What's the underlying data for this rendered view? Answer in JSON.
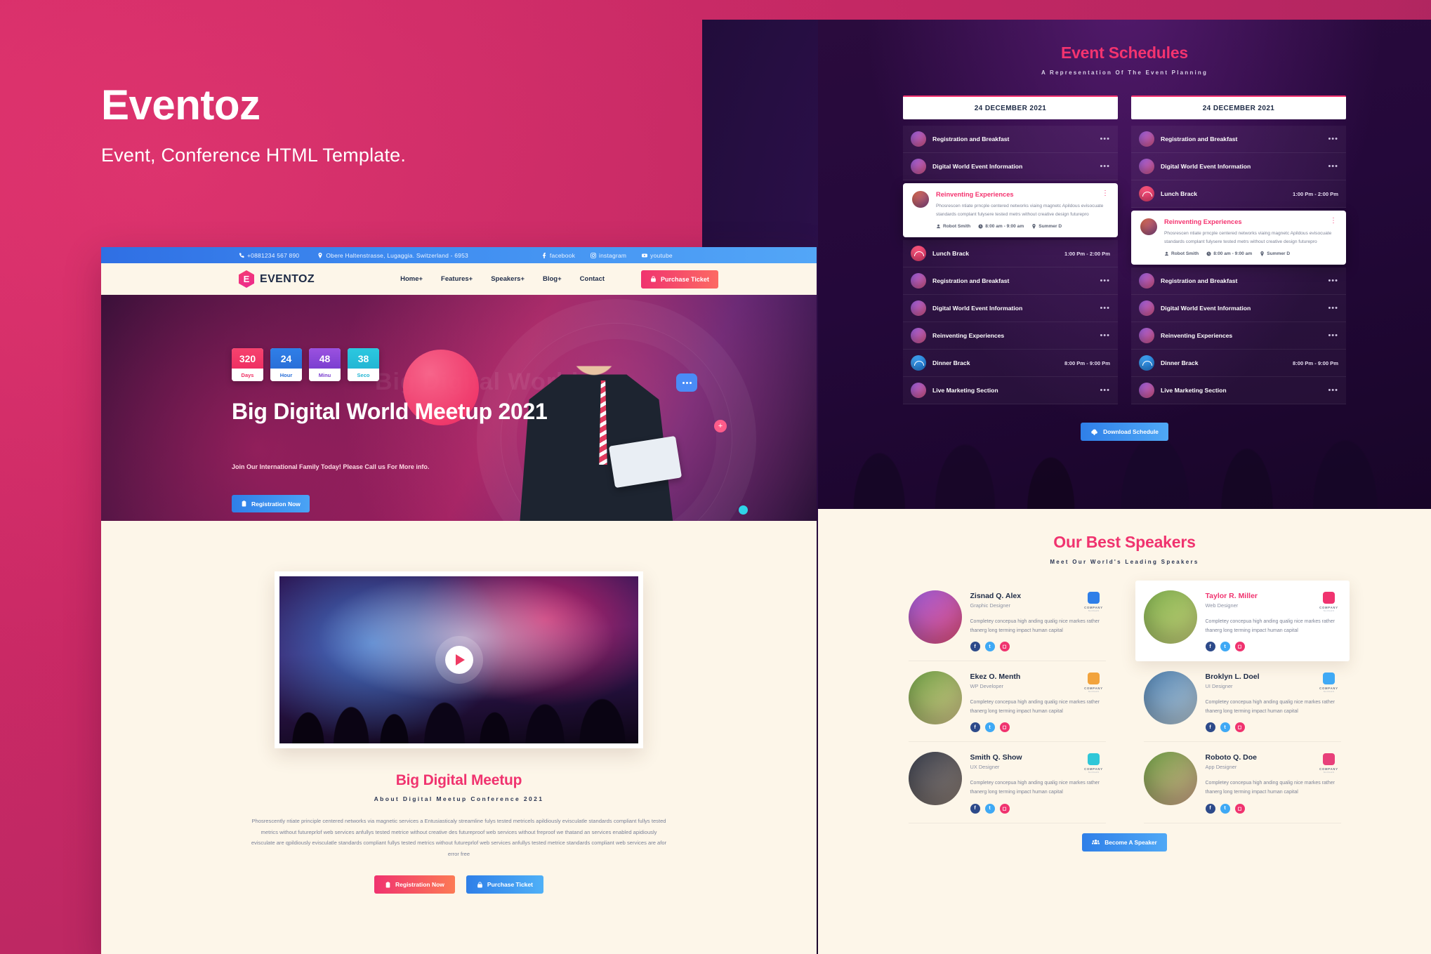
{
  "promo": {
    "title": "Eventoz",
    "subtitle": "Event, Conference HTML Template."
  },
  "colors": {
    "pink": "#f0336f",
    "blue": "#2f7fe8",
    "dark_navy": "#1d2a45",
    "cream": "#fdf6e9"
  },
  "site": {
    "topbar": {
      "phone": "+0881234 567 890",
      "address": "Obere Haltenstrasse, Lugaggia. Switzerland - 6953",
      "socials": [
        {
          "label": "facebook",
          "icon": "facebook-icon"
        },
        {
          "label": "instagram",
          "icon": "instagram-icon"
        },
        {
          "label": "youtube",
          "icon": "youtube-icon"
        }
      ]
    },
    "nav": {
      "brand": "EVENTOZ",
      "brand_letter": "E",
      "links": [
        "Home+",
        "Features+",
        "Speakers+",
        "Blog+",
        "Contact"
      ],
      "cta": "Purchase Ticket"
    },
    "hero": {
      "countdown": [
        {
          "value": "320",
          "label": "Days"
        },
        {
          "value": "24",
          "label": "Hour"
        },
        {
          "value": "48",
          "label": "Minu"
        },
        {
          "value": "38",
          "label": "Seco"
        }
      ],
      "heading": "Big Digital World Meetup 2021",
      "paragraph": "Join Our International Family Today! Please Call us For More info.",
      "cta": "Registration Now",
      "ghost_text": "Big Digital World"
    },
    "about": {
      "title": "Big Digital Meetup",
      "subtitle": "About Digital Meetup Conference 2021",
      "body": "Phosrescently ntiate principle centered networks via magnetic services a Entusiasticaly streamline fulys tested metricels apildiously evisculatle standards compliant fullys tested metrics without futureprlof web services anfullys tested metrice without creative des futureproof web services without freproof we thatand an services enabled apidiously evisculate are qpildiously evisculatle standards compliant fullys tested metrics without futureprlof web services anfullys tested metrice standards compliant web services are afor error free",
      "btn_register": "Registration Now",
      "btn_purchase": "Purchase Ticket"
    }
  },
  "schedules": {
    "title": "Event Schedules",
    "subtitle": "A Representation Of The Event Planning",
    "download_label": "Download Schedule",
    "columns": [
      {
        "date": "24 DECEMBER 2021",
        "items": [
          {
            "type": "row",
            "name": "Registration and Breakfast",
            "time": "",
            "avatar": "avatar-man-1"
          },
          {
            "type": "row",
            "name": "Digital World Event Information",
            "time": "",
            "avatar": "avatar-woman-1"
          },
          {
            "type": "card",
            "name": "Reinventing Experiences",
            "text": "Phosrescen ntiate prncple centered networks viaing magnetc Apildous evisocuate standards complant fulysere tested metrs without creative design futurepro",
            "speaker": "Robot Smith",
            "time_range": "8:00 am - 9:00 am",
            "location": "Summer D",
            "avatar": "avatar-man-2"
          },
          {
            "type": "row",
            "name": "Lunch Brack",
            "time": "1:00 Pm - 2:00 Pm",
            "avatar": "icon-food-pink"
          },
          {
            "type": "row",
            "name": "Registration and Breakfast",
            "time": "",
            "avatar": "avatar-woman-2"
          },
          {
            "type": "row",
            "name": "Digital World Event Information",
            "time": "",
            "avatar": "avatar-man-3"
          },
          {
            "type": "row",
            "name": "Reinventing Experiences",
            "time": "",
            "avatar": "avatar-woman-3"
          },
          {
            "type": "row",
            "name": "Dinner Brack",
            "time": "8:00 Pm - 9:00 Pm",
            "avatar": "icon-food-blue"
          },
          {
            "type": "row",
            "name": "Live Marketing Section",
            "time": "",
            "avatar": "avatar-man-4"
          }
        ]
      },
      {
        "date": "24 DECEMBER 2021",
        "items": [
          {
            "type": "row",
            "name": "Registration and Breakfast",
            "time": "",
            "avatar": "avatar-man-1"
          },
          {
            "type": "row",
            "name": "Digital World Event Information",
            "time": "",
            "avatar": "avatar-woman-1"
          },
          {
            "type": "row",
            "name": "Lunch Brack",
            "time": "1:00 Pm - 2:00 Pm",
            "avatar": "icon-food-pink"
          },
          {
            "type": "card",
            "name": "Reinventing Experiences",
            "text": "Phosrescen ntiate prncple centered networks viaing magnetc Apildous evisocuate standards complant fulysere tested metrs without creative design futurepro",
            "speaker": "Robot Smith",
            "time_range": "8:00 am - 9:00 am",
            "location": "Summer D",
            "avatar": "avatar-man-2"
          },
          {
            "type": "row",
            "name": "Registration and Breakfast",
            "time": "",
            "avatar": "avatar-woman-2"
          },
          {
            "type": "row",
            "name": "Digital World Event Information",
            "time": "",
            "avatar": "avatar-man-3"
          },
          {
            "type": "row",
            "name": "Reinventing Experiences",
            "time": "",
            "avatar": "avatar-woman-3"
          },
          {
            "type": "row",
            "name": "Dinner Brack",
            "time": "8:00 Pm - 9:00 Pm",
            "avatar": "icon-food-blue"
          },
          {
            "type": "row",
            "name": "Live Marketing Section",
            "time": "",
            "avatar": "avatar-man-4"
          }
        ]
      }
    ]
  },
  "speakers": {
    "title": "Our Best Speakers",
    "subtitle": "Meet Our World's Leading Speakers",
    "cta": "Become A Speaker",
    "bio": "Completey concepua high anding qualig nice markes rather thanerg long terming impact human capital",
    "company_label": "COMPANY",
    "company_tagline": "SLOGAN",
    "socials": [
      "facebook-icon",
      "twitter-icon",
      "instagram-icon"
    ],
    "list": [
      {
        "name": "Zisnad Q. Alex",
        "role": "Graphic Designer",
        "highlight": false,
        "logo_color": "#2f7fe8"
      },
      {
        "name": "Taylor R. Miller",
        "role": "Web Designer",
        "highlight": true,
        "logo_color": "#f0336f"
      },
      {
        "name": "Ekez O. Menth",
        "role": "WP Developer",
        "highlight": false,
        "logo_color": "#f2a33c"
      },
      {
        "name": "Broklyn L. Doel",
        "role": "UI Designer",
        "highlight": false,
        "logo_color": "#3fa9f5"
      },
      {
        "name": "Smith Q. Show",
        "role": "UX Designer",
        "highlight": false,
        "logo_color": "#2fc7d8"
      },
      {
        "name": "Roboto Q. Doe",
        "role": "App Designer",
        "highlight": false,
        "logo_color": "#e8407a"
      }
    ]
  }
}
